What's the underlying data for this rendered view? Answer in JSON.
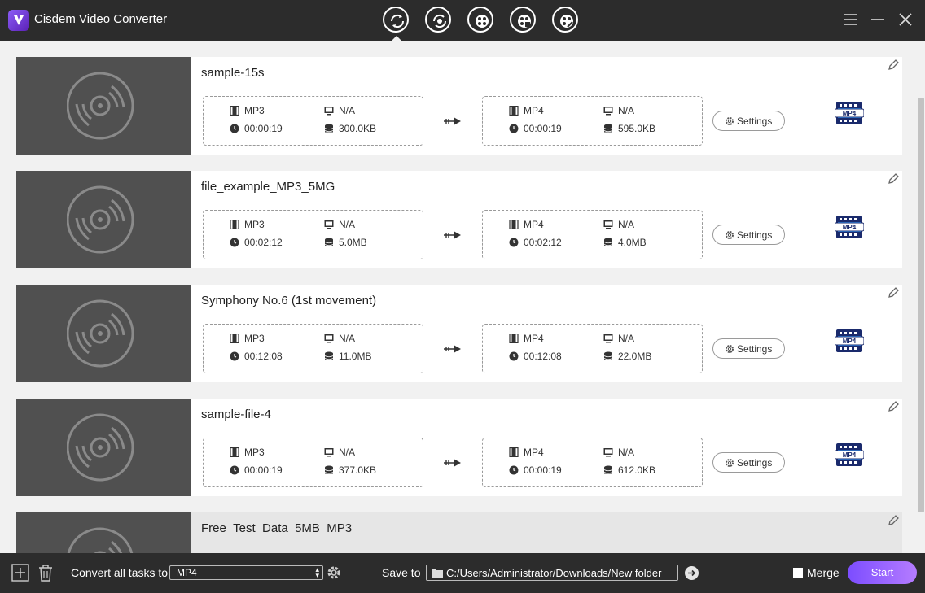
{
  "app": {
    "title": "Cisdem Video Converter"
  },
  "toolbar": {
    "modes": [
      {
        "name": "convert-mode-icon"
      },
      {
        "name": "rip-dvd-mode-icon"
      },
      {
        "name": "download-mode-icon"
      },
      {
        "name": "compress-mode-icon"
      },
      {
        "name": "merge-mode-icon"
      }
    ],
    "window_buttons": [
      "menu-icon",
      "minimize-icon",
      "close-icon"
    ]
  },
  "tasks": [
    {
      "title": "sample-15s",
      "src": {
        "format": "MP3",
        "resolution": "N/A",
        "duration": "00:00:19",
        "size": "300.0KB"
      },
      "dst": {
        "format": "MP4",
        "resolution": "N/A",
        "duration": "00:00:19",
        "size": "595.0KB"
      }
    },
    {
      "title": "file_example_MP3_5MG",
      "src": {
        "format": "MP3",
        "resolution": "N/A",
        "duration": "00:02:12",
        "size": "5.0MB"
      },
      "dst": {
        "format": "MP4",
        "resolution": "N/A",
        "duration": "00:02:12",
        "size": "4.0MB"
      }
    },
    {
      "title": "Symphony No.6 (1st movement)",
      "src": {
        "format": "MP3",
        "resolution": "N/A",
        "duration": "00:12:08",
        "size": "11.0MB"
      },
      "dst": {
        "format": "MP4",
        "resolution": "N/A",
        "duration": "00:12:08",
        "size": "22.0MB"
      }
    },
    {
      "title": "sample-file-4",
      "src": {
        "format": "MP3",
        "resolution": "N/A",
        "duration": "00:00:19",
        "size": "377.0KB"
      },
      "dst": {
        "format": "MP4",
        "resolution": "N/A",
        "duration": "00:00:19",
        "size": "612.0KB"
      }
    },
    {
      "title": "Free_Test_Data_5MB_MP3"
    }
  ],
  "labels": {
    "settings": "Settings",
    "format_badge": "MP4"
  },
  "bottom": {
    "convert_all_label": "Convert all tasks to",
    "convert_all_value": "MP4",
    "save_to_label": "Save to",
    "save_path": "C:/Users/Administrator/Downloads/New folder",
    "merge_label": "Merge",
    "start_label": "Start"
  },
  "colors": {
    "accent": "#8b5cf6",
    "titlebar": "#2c2c2c",
    "thumb": "#505050"
  }
}
